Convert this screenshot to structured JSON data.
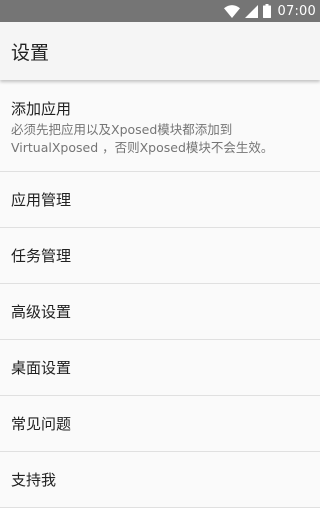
{
  "status_bar": {
    "time": "07:00",
    "icons": [
      "wifi-icon",
      "signal-icon",
      "battery-icon"
    ]
  },
  "app_bar": {
    "title": "设置"
  },
  "items": [
    {
      "title": "添加应用",
      "summary": "必须先把应用以及Xposed模块都添加到\nVirtualXposed ，否则Xposed模块不会生效。"
    },
    {
      "title": "应用管理"
    },
    {
      "title": "任务管理"
    },
    {
      "title": "高级设置"
    },
    {
      "title": "桌面设置"
    },
    {
      "title": "常见问题"
    },
    {
      "title": "支持我"
    }
  ]
}
